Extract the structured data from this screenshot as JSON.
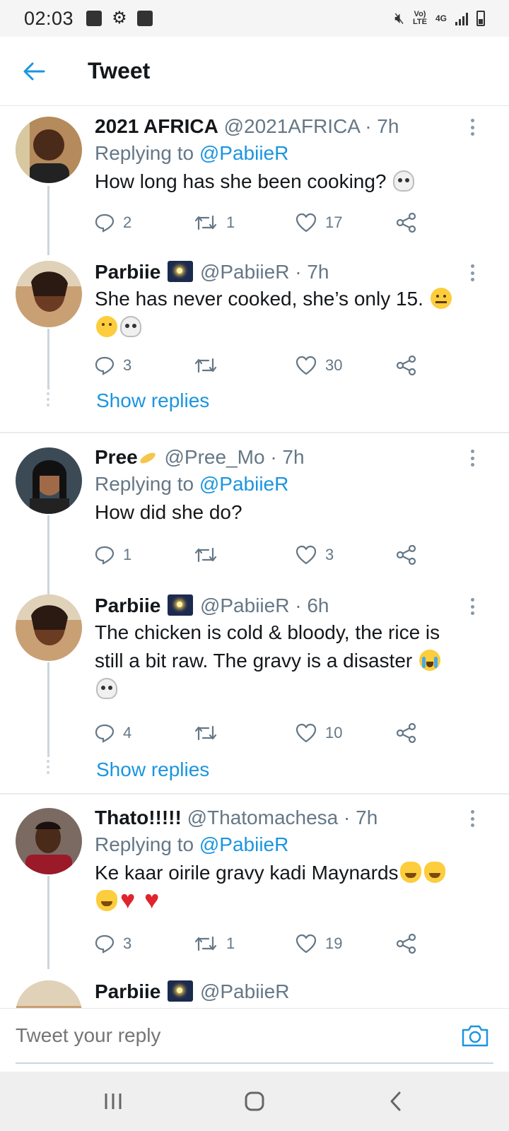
{
  "status_bar": {
    "time": "02:03",
    "network_top": "Vo)",
    "network_bottom": "LTE",
    "data_type": "4G"
  },
  "header": {
    "title": "Tweet"
  },
  "tweets": [
    {
      "name": "2021 AFRICA",
      "handle": "@2021AFRICA",
      "time": "· 7h",
      "replying_prefix": "Replying to",
      "replying_to": "@PabiieR",
      "text": "How long has she been cooking?",
      "emojis": [
        "skull"
      ],
      "replies": "2",
      "retweets": "1",
      "likes": "17",
      "avatar_color": "#6b3a22"
    },
    {
      "name": "Parbiie",
      "handle": "@PabiieR",
      "time": "· 7h",
      "text": "She has never cooked, she’s only 15.",
      "emojis": [
        "zipper-mouth-face",
        "face-with-raised-eyebrow",
        "skull"
      ],
      "replies": "3",
      "retweets": "",
      "likes": "30",
      "show_replies": "Show replies",
      "avatar_color": "#8a5a3c"
    },
    {
      "name": "Pree",
      "handle": "@Pree_Mo",
      "time": "· 7h",
      "replying_prefix": "Replying to",
      "replying_to": "@PabiieR",
      "text": "How did she do?",
      "replies": "1",
      "retweets": "",
      "likes": "3",
      "avatar_color": "#3a2a2a"
    },
    {
      "name": "Parbiie",
      "handle": "@PabiieR",
      "time": "· 6h",
      "text_line1": "The chicken is cold & bloody, the rice is",
      "text_line2": "still a bit raw. The gravy is a disaster",
      "emojis": [
        "loudly-crying-face",
        "skull"
      ],
      "replies": "4",
      "retweets": "",
      "likes": "10",
      "show_replies": "Show replies",
      "avatar_color": "#8a5a3c"
    },
    {
      "name": "Thato!!!!!",
      "handle": "@Thatomachesa",
      "time": "· 7h",
      "replying_prefix": "Replying to",
      "replying_to": "@PabiieR",
      "text": "Ke kaar oirile gravy kadi Maynards",
      "emojis": [
        "cat-with-tears-of-joy",
        "cat-with-tears-of-joy",
        "cat-with-tears-of-joy",
        "red-heart",
        "red-heart"
      ],
      "replies": "3",
      "retweets": "1",
      "likes": "19",
      "avatar_color": "#5a2a2a"
    }
  ],
  "reply_bar": {
    "placeholder": "Tweet your reply"
  },
  "colors": {
    "accent": "#1b95e0",
    "text": "#14171a",
    "muted": "#657786",
    "divider": "#e6ecf0"
  }
}
